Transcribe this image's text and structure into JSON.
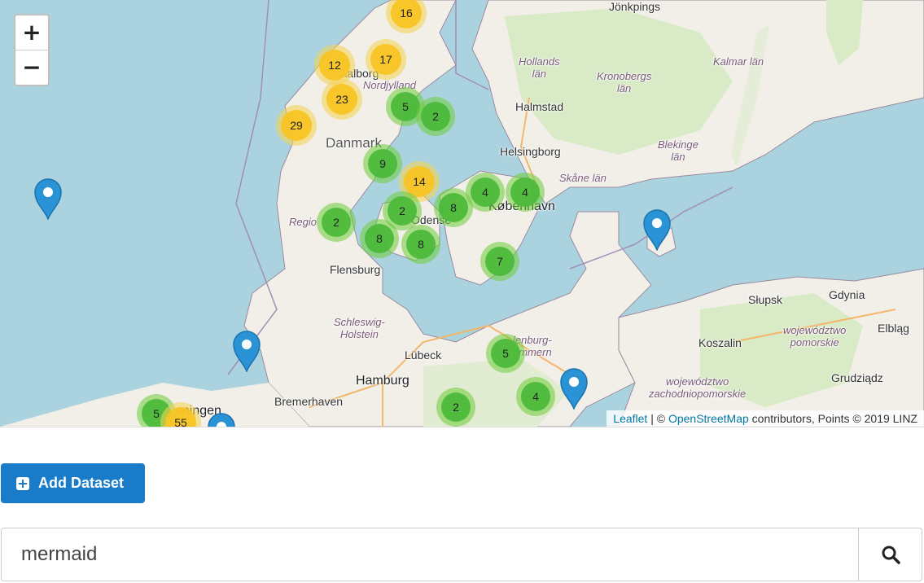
{
  "map": {
    "zoom_in": "+",
    "zoom_out": "−",
    "places": {
      "jonkopings": "Jönkpings",
      "hollands": "Hollands\nlän",
      "kronobergs": "Kronobergs\nlän",
      "kalmar": "Kalmar län",
      "halmstad": "Halmstad",
      "nordjylland": "Nordjylland",
      "aalborg": "Aalborg",
      "danmark": "Danmark",
      "helsingborg": "Helsingborg",
      "blekinge": "Blekinge\nlän",
      "skane": "Skåne län",
      "kobenhavn": "København",
      "region": "Regio",
      "odense": "Odense",
      "flensburg": "Flensburg",
      "slupsk": "Słupsk",
      "gdynia": "Gdynia",
      "koszalin": "Koszalin",
      "pomorskie": "województwo\npomorskie",
      "elblag": "Elbląg",
      "schleswig": "Schleswig-\nHolstein",
      "lubeck": "Lübeck",
      "mecklenburg": "lenburg-\nommern",
      "hamburg": "Hamburg",
      "zachodnio": "województwo\nzachodniopomorskie",
      "grudziadz": "Grudziądz",
      "bremerhaven": "Bremerhaven",
      "groningen": "oningen"
    },
    "clusters": [
      {
        "count": "16",
        "color": "yellow"
      },
      {
        "count": "12",
        "color": "yellow"
      },
      {
        "count": "17",
        "color": "yellow"
      },
      {
        "count": "23",
        "color": "yellow"
      },
      {
        "count": "29",
        "color": "yellow"
      },
      {
        "count": "5",
        "color": "green"
      },
      {
        "count": "2",
        "color": "green"
      },
      {
        "count": "9",
        "color": "green"
      },
      {
        "count": "14",
        "color": "yellow"
      },
      {
        "count": "4",
        "color": "green"
      },
      {
        "count": "4",
        "color": "green"
      },
      {
        "count": "2",
        "color": "green"
      },
      {
        "count": "8",
        "color": "green"
      },
      {
        "count": "2",
        "color": "green"
      },
      {
        "count": "8",
        "color": "green"
      },
      {
        "count": "8",
        "color": "green"
      },
      {
        "count": "7",
        "color": "green"
      },
      {
        "count": "5",
        "color": "green"
      },
      {
        "count": "4",
        "color": "green"
      },
      {
        "count": "2",
        "color": "green"
      },
      {
        "count": "5",
        "color": "green"
      },
      {
        "count": "55",
        "color": "yellow"
      }
    ],
    "attribution": {
      "leaflet": "Leaflet",
      "sep": " | © ",
      "osm": "OpenStreetMap",
      "rest": " contributors, Points © 2019 LINZ"
    },
    "colors": {
      "water": "#aad3df",
      "land": "#f2efe9",
      "forest": "#cde6b3",
      "marker": "#2a93d5"
    }
  },
  "toolbar": {
    "add_dataset_label": "Add Dataset"
  },
  "search": {
    "value": "mermaid"
  }
}
